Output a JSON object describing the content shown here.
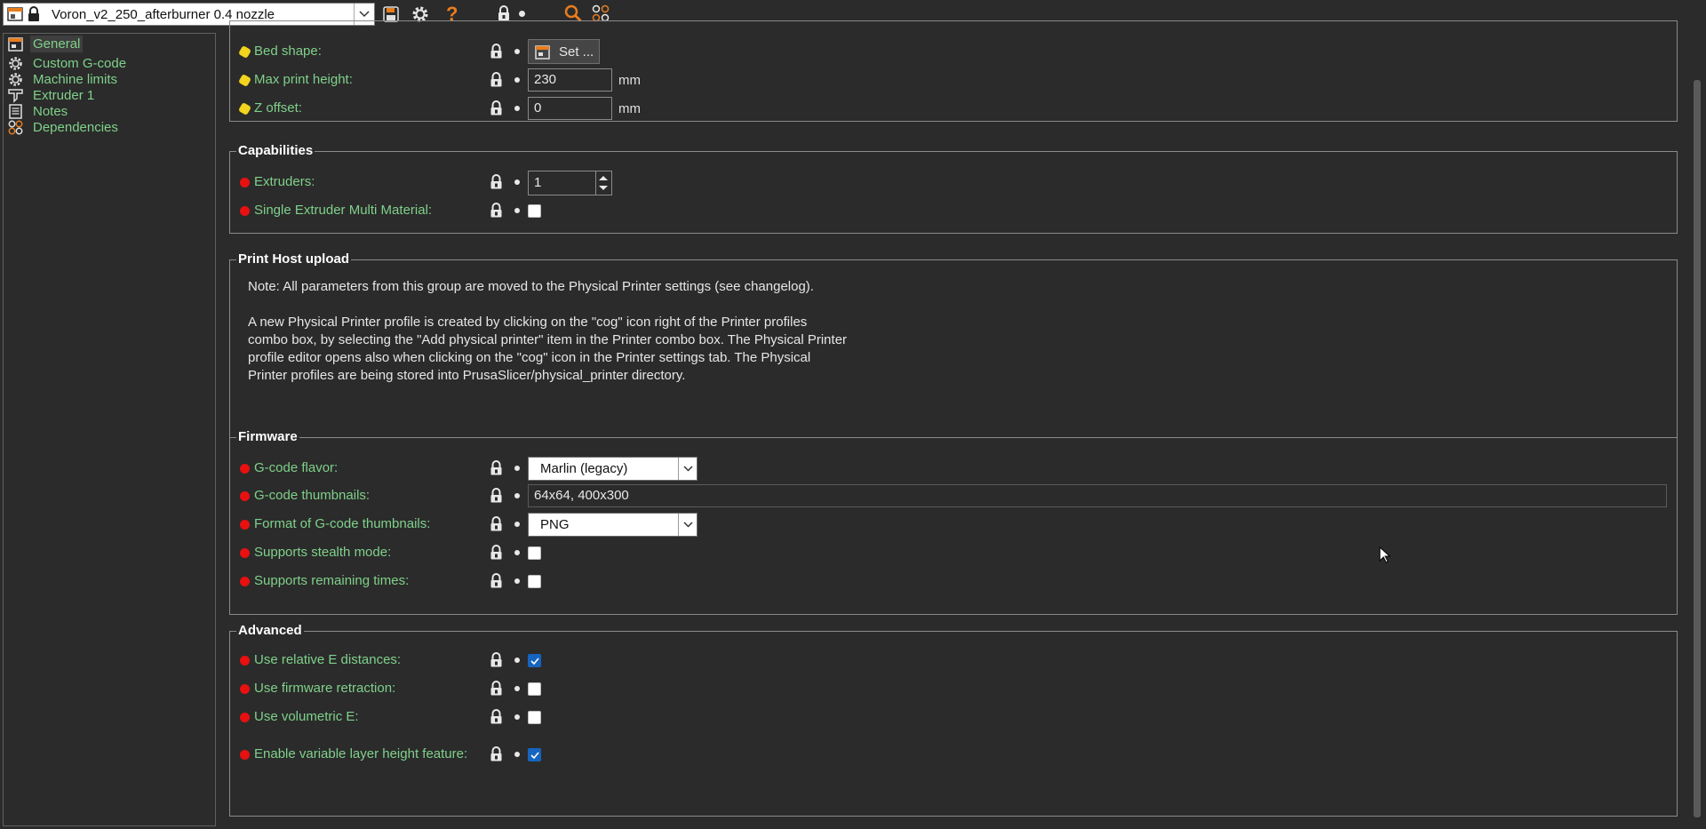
{
  "toolbar": {
    "preset_name": "Voron_v2_250_afterburner 0.4 nozzle"
  },
  "sidebar": {
    "items": [
      {
        "label": "General",
        "icon": "printer-icon"
      },
      {
        "label": "Custom G-code",
        "icon": "cog-icon"
      },
      {
        "label": "Machine limits",
        "icon": "cog-icon"
      },
      {
        "label": "Extruder 1",
        "icon": "funnel-icon"
      },
      {
        "label": "Notes",
        "icon": "note-icon"
      },
      {
        "label": "Dependencies",
        "icon": "wrench-icon"
      }
    ]
  },
  "general": {
    "bed_shape": {
      "label": "Bed shape:",
      "button": "Set ..."
    },
    "max_print_height": {
      "label": "Max print height:",
      "value": "230",
      "unit": "mm"
    },
    "z_offset": {
      "label": "Z offset:",
      "value": "0",
      "unit": "mm"
    }
  },
  "capabilities": {
    "title": "Capabilities",
    "extruders": {
      "label": "Extruders:",
      "value": "1"
    },
    "semm": {
      "label": "Single Extruder Multi Material:",
      "checked": false
    }
  },
  "print_host": {
    "title": "Print Host upload",
    "note1": "Note: All parameters from this group are moved to the Physical Printer settings (see changelog).",
    "note2": "A new Physical Printer profile is created by clicking on the \"cog\" icon right of the Printer profiles\ncombo box, by selecting the \"Add physical printer\" item in the Printer combo box. The Physical Printer\nprofile editor opens also when clicking on the \"cog\" icon in the Printer settings tab. The Physical\nPrinter profiles are being stored into PrusaSlicer/physical_printer directory."
  },
  "firmware": {
    "title": "Firmware",
    "gcode_flavor": {
      "label": "G-code flavor:",
      "value": "Marlin (legacy)"
    },
    "thumbnails": {
      "label": "G-code thumbnails:",
      "value": "64x64, 400x300"
    },
    "thumb_format": {
      "label": "Format of G-code thumbnails:",
      "value": "PNG"
    },
    "stealth": {
      "label": "Supports stealth mode:",
      "checked": false
    },
    "remaining": {
      "label": "Supports remaining times:",
      "checked": false
    }
  },
  "advanced": {
    "title": "Advanced",
    "relative_e": {
      "label": "Use relative E distances:",
      "checked": true
    },
    "fw_retraction": {
      "label": "Use firmware retraction:",
      "checked": false
    },
    "volumetric_e": {
      "label": "Use volumetric E:",
      "checked": false
    },
    "variable_layer": {
      "label": "Enable variable layer height feature:",
      "checked": true
    }
  },
  "colors": {
    "label_green": "#7fd18a",
    "required_red": "#e81010",
    "simple_yellow": "#f2d41e",
    "accent_orange": "#e87d1e",
    "checkbox_blue": "#1565c0"
  }
}
